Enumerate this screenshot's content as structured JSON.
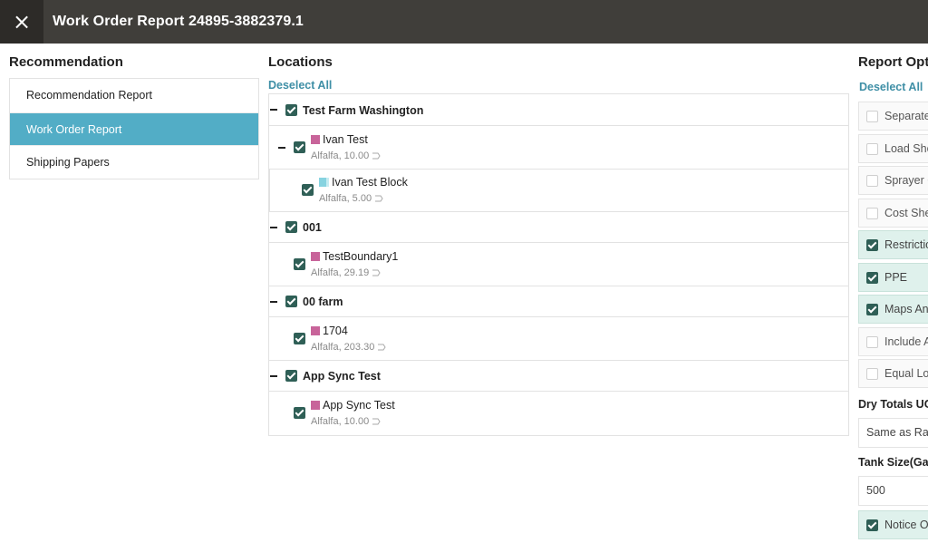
{
  "titlebar": {
    "title": "Work Order Report 24895-3882379.1",
    "close_icon": "×"
  },
  "recommendation": {
    "heading": "Recommendation",
    "items": [
      {
        "label": "Recommendation Report",
        "active": false
      },
      {
        "label": "Work Order Report",
        "active": true
      },
      {
        "label": "Shipping Papers",
        "active": false
      }
    ]
  },
  "locations": {
    "heading": "Locations",
    "deselect": "Deselect All",
    "farms": [
      {
        "name": "Test Farm Washington",
        "fields": [
          {
            "name": "Ivan Test",
            "detail": "Alfalfa, 10.00",
            "color": "#c8649a",
            "blocks": [
              {
                "name": "Ivan Test Block",
                "detail": "Alfalfa, 5.00",
                "color": "#87d3e0"
              }
            ]
          }
        ]
      },
      {
        "name": "001",
        "fields": [
          {
            "name": "TestBoundary1",
            "detail": "Alfalfa, 29.19",
            "color": "#c8649a"
          }
        ]
      },
      {
        "name": "00 farm",
        "fields": [
          {
            "name": "1704",
            "detail": "Alfalfa, 203.30",
            "color": "#c8649a"
          }
        ]
      },
      {
        "name": "App Sync Test",
        "fields": [
          {
            "name": "App Sync Test",
            "detail": "Alfalfa, 10.00",
            "color": "#c8649a"
          }
        ]
      }
    ]
  },
  "report_options": {
    "heading": "Report Opt",
    "deselect": "Deselect All",
    "options": [
      {
        "label": "Separate",
        "checked": false
      },
      {
        "label": "Load She",
        "checked": false
      },
      {
        "label": "Sprayer C",
        "checked": false
      },
      {
        "label": "Cost She",
        "checked": false
      },
      {
        "label": "Restrictio",
        "checked": true
      },
      {
        "label": "PPE",
        "checked": true
      },
      {
        "label": "Maps An",
        "checked": true
      },
      {
        "label": "Include A",
        "checked": false
      },
      {
        "label": "Equal Loa",
        "checked": false
      }
    ],
    "dry_totals_label": "Dry Totals UO",
    "dry_totals_value": "Same as Rate",
    "tank_size_label": "Tank Size(Gall",
    "tank_size_value": "500",
    "notice": {
      "label": "Notice O",
      "checked": true
    }
  },
  "colors": {
    "accent": "#52adc6",
    "checkbox": "#2f5f56",
    "titlebar": "#403e3a"
  }
}
